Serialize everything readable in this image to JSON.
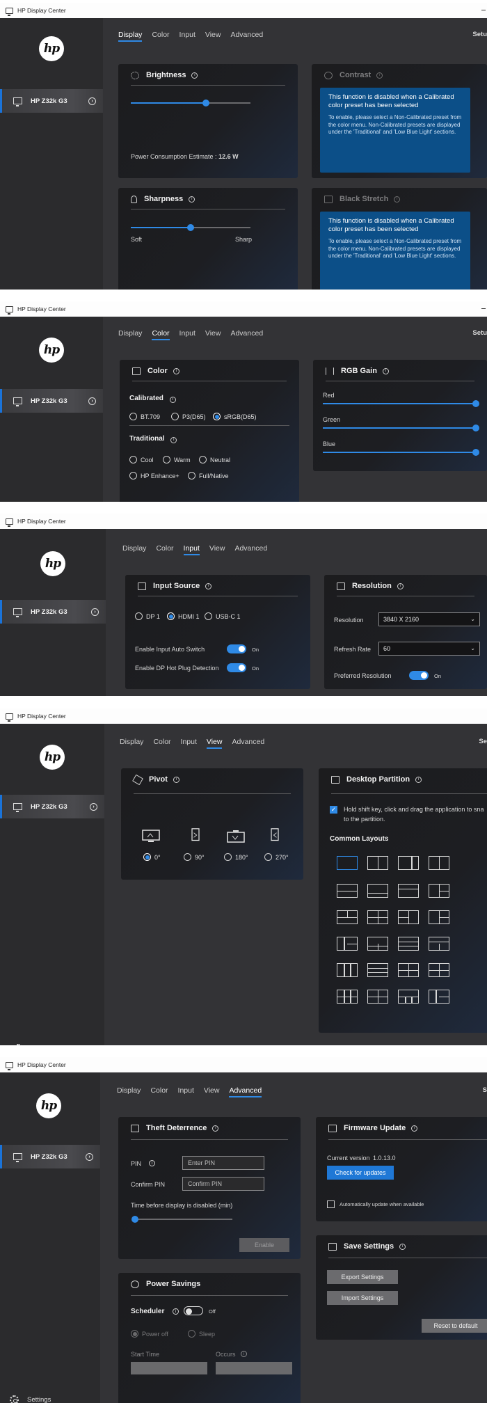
{
  "app": {
    "title": "HP Display Center",
    "logo": "hp"
  },
  "sidebar": {
    "device_name": "HP Z32k G3",
    "settings_label": "Settings"
  },
  "tabs": [
    "Display",
    "Color",
    "Input",
    "View",
    "Advanced"
  ],
  "setup_label": "Setu",
  "display": {
    "active_tab": "Display",
    "brightness": {
      "title": "Brightness",
      "level": 0.63,
      "power_label": "Power Consumption Estimate :",
      "power_value": "12.6 W"
    },
    "contrast": {
      "title": "Contrast"
    },
    "sharpness": {
      "title": "Sharpness",
      "level": 0.5,
      "min_label": "Soft",
      "max_label": "Sharp"
    },
    "black_stretch": {
      "title": "Black Stretch"
    },
    "notice_heading": "This function is disabled when a Calibrated color preset has been selected",
    "notice_body_1": "To enable, please select a Non-Calibrated preset from the color menu. Non-Calibrated presets are displayed under the 'Traditional' and 'Low Blue Light' sections.",
    "notice_body_2": "To enable, please select a Non-Calibrated preset from the color menu. Non-Calibrated presets are displayed under the 'Traditional' and 'Low Blue Light' sections."
  },
  "color": {
    "active_tab": "Color",
    "panel_title": "Color",
    "calibrated_label": "Calibrated",
    "calibrated_options": [
      "BT.709",
      "P3(D65)",
      "sRGB(D65)"
    ],
    "calibrated_selected": "sRGB(D65)",
    "traditional_label": "Traditional",
    "traditional_options": [
      "Cool",
      "Warm",
      "Neutral",
      "HP Enhance+",
      "Full/Native"
    ],
    "rgb_title": "RGB Gain",
    "rgb": [
      {
        "label": "Red",
        "level": 1.0
      },
      {
        "label": "Green",
        "level": 1.0
      },
      {
        "label": "Blue",
        "level": 1.0
      }
    ]
  },
  "input": {
    "active_tab": "Input",
    "source_title": "Input Source",
    "sources": [
      "DP 1",
      "HDMI 1",
      "USB-C 1"
    ],
    "source_selected": "HDMI 1",
    "auto_switch_label": "Enable Input Auto Switch",
    "auto_switch_state": "On",
    "hot_plug_label": "Enable DP Hot Plug Detection",
    "hot_plug_state": "On",
    "resolution_title": "Resolution",
    "resolution_label": "Resolution",
    "resolution_value": "3840 X 2160",
    "refresh_label": "Refresh Rate",
    "refresh_value": "60",
    "preferred_label": "Preferred Resolution",
    "preferred_state": "On"
  },
  "view": {
    "active_tab": "View",
    "setup_label": "Se",
    "pivot_title": "Pivot",
    "pivot_options": [
      "0°",
      "90°",
      "180°",
      "270°"
    ],
    "pivot_selected": "0°",
    "partition_title": "Desktop Partition",
    "partition_hint": "Hold shift key, click and drag the application to sna",
    "partition_hint_2": "to the partition.",
    "layouts_label": "Common Layouts"
  },
  "advanced": {
    "active_tab": "Advanced",
    "setup_label": "S",
    "theft_title": "Theft Deterrence",
    "pin_label": "PIN",
    "pin_placeholder": "Enter PIN",
    "confirm_label": "Confirm PIN",
    "confirm_placeholder": "Confirm PIN",
    "timer_label": "Time before display is disabled (min)",
    "timer_level": 0.0,
    "enable_label": "Enable",
    "firmware_title": "Firmware Update",
    "current_version_label": "Current version",
    "current_version": "1.0.13.0",
    "check_updates_label": "Check for updates",
    "auto_update_label": "Automatically update when available",
    "save_title": "Save Settings",
    "export_label": "Export Settings",
    "import_label": "Import Settings",
    "reset_label": "Reset to default",
    "power_title": "Power Savings",
    "scheduler_label": "Scheduler",
    "scheduler_state": "Off",
    "power_off_label": "Power off",
    "sleep_label": "Sleep",
    "start_time_label": "Start Time",
    "occurs_label": "Occurs"
  },
  "colors": {
    "accent": "#2f8ae6",
    "notice": "#0c4f88",
    "background": "#333336",
    "sidebar": "#2b2b2d"
  }
}
